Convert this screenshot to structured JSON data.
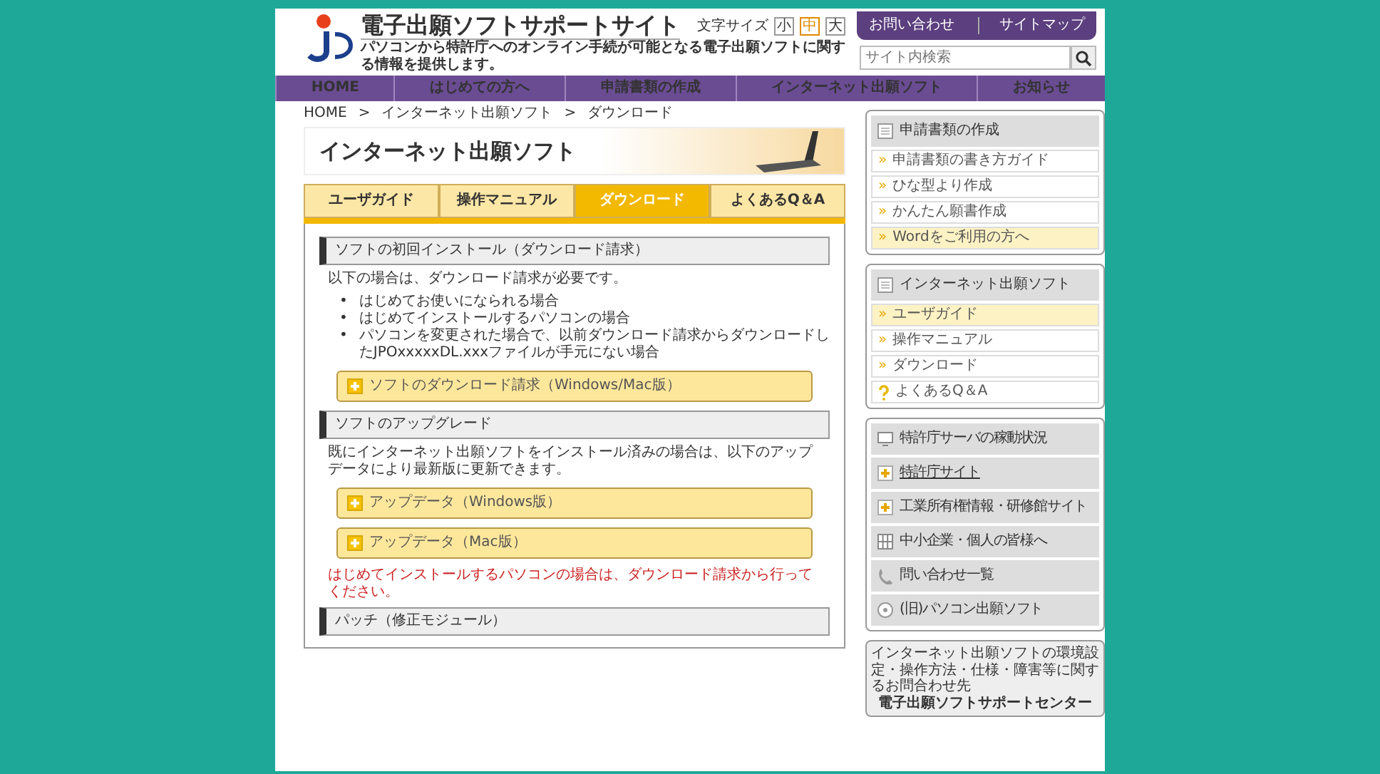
{
  "header": {
    "title": "電子出願ソフトサポートサイト",
    "subtitle": "パソコンから特許庁へのオンライン手続が可能となる電子出願ソフトに関する情報を提供します。",
    "font_size_label": "文字サイズ",
    "font_sizes": [
      {
        "label": "小",
        "selected": false
      },
      {
        "label": "中",
        "selected": true
      },
      {
        "label": "大",
        "selected": false
      }
    ],
    "links": [
      "お問い合わせ",
      "サイトマップ"
    ],
    "search": {
      "placeholder": "サイト内検索"
    }
  },
  "nav": [
    "HOME",
    "はじめての方へ",
    "申請書類の作成",
    "インターネット出願ソフト",
    "お知らせ"
  ],
  "breadcrumb": {
    "items": [
      "HOME",
      "インターネット出願ソフト",
      "ダウンロード"
    ],
    "separators": [
      ">",
      ">"
    ]
  },
  "page_title": "インターネット出願ソフト",
  "tabs": [
    {
      "label": "ユーザガイド",
      "selected": false
    },
    {
      "label": "操作マニュアル",
      "selected": false
    },
    {
      "label": "ダウンロード",
      "selected": true
    },
    {
      "label": "よくあるQ＆A",
      "selected": false
    }
  ],
  "sections": [
    {
      "heading": "ソフトの初回インストール（ダウンロード請求）",
      "paragraph": "以下の場合は、ダウンロード請求が必要です。",
      "bullets": [
        {
          "marker": "•",
          "text": "はじめてお使いになられる場合"
        },
        {
          "marker": "•",
          "text": "はじめてインストールするパソコンの場合"
        },
        {
          "marker": "•",
          "text": "パソコンを変更された場合で、以前ダウンロード請求からダウンロードしたJPOxxxxxDL.xxxファイルが手元にない場合"
        }
      ],
      "buttons": [
        "ソフトのダウンロード請求（Windows/Mac版）"
      ]
    },
    {
      "heading": "ソフトのアップグレード",
      "paragraph": "既にインターネット出願ソフトをインストール済みの場合は、以下のアップデータにより最新版に更新できます。",
      "buttons": [
        "アップデータ（Windows版）",
        "アップデータ（Mac版）"
      ],
      "note": "はじめてインストールするパソコンの場合は、ダウンロード請求から行ってください。"
    },
    {
      "heading": "パッチ（修正モジュール）"
    }
  ],
  "sidebar": {
    "groups": [
      {
        "title": "申請書類の作成",
        "items": [
          {
            "kind": "link",
            "marker": "»",
            "label": "申請書類の書き方ガイド",
            "highlighted": false
          },
          {
            "kind": "link",
            "marker": "»",
            "label": "ひな型より作成",
            "highlighted": false
          },
          {
            "kind": "link",
            "marker": "»",
            "label": "かんたん願書作成",
            "highlighted": false
          },
          {
            "kind": "link",
            "marker": "»",
            "label": "Wordをご利用の方へ",
            "highlighted": true
          }
        ]
      },
      {
        "title": "インターネット出願ソフト",
        "items": [
          {
            "kind": "link",
            "marker": "»",
            "label": "ユーザガイド",
            "highlighted": true
          },
          {
            "kind": "link",
            "marker": "»",
            "label": "操作マニュアル",
            "highlighted": false
          },
          {
            "kind": "link",
            "marker": "»",
            "label": "ダウンロード",
            "highlighted": false
          },
          {
            "kind": "faq",
            "label": "よくあるQ＆A",
            "highlighted": false
          }
        ]
      }
    ],
    "links": [
      {
        "kind": "monitor",
        "label": "特許庁サーバの稼動状況",
        "underlined": false
      },
      {
        "kind": "plus",
        "label": "特許庁サイト",
        "underlined": true
      },
      {
        "kind": "plus",
        "label": "工業所有権情報・研修館サイト",
        "underlined": false
      },
      {
        "kind": "grid",
        "label": "中小企業・個人の皆様へ",
        "underlined": false
      },
      {
        "kind": "phone",
        "label": "問い合わせ一覧",
        "underlined": false
      },
      {
        "kind": "circle",
        "label": "(旧)パソコン出願ソフト",
        "underlined": false
      }
    ],
    "contact": {
      "text": "インターネット出願ソフトの環境設定・操作方法・仕様・障害等に関するお問合わせ先",
      "center": "電子出願ソフトサポートセンター"
    }
  }
}
